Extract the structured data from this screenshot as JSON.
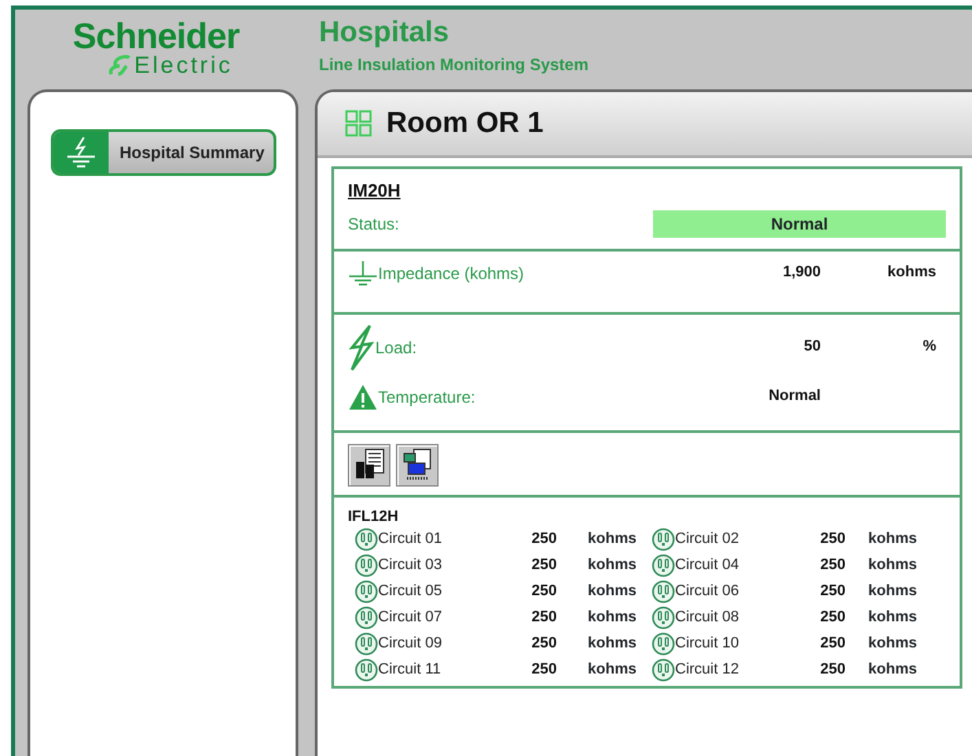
{
  "brand": {
    "name": "Schneider",
    "sub": "Electric"
  },
  "app": {
    "title": "Hospitals",
    "subtitle": "Line Insulation Monitoring System"
  },
  "sidebar": {
    "items": [
      {
        "label": "Hospital Summary",
        "selected": true
      }
    ]
  },
  "room": {
    "title": "Room OR 1"
  },
  "device": {
    "name": "IM20H",
    "status_label": "Status:",
    "status": "Normal",
    "groups": [
      {
        "items": [
          {
            "kind": "impedance",
            "label": "Impedance (kohms)",
            "value": "1,900",
            "unit": "kohms"
          }
        ]
      },
      {
        "items": [
          {
            "kind": "load",
            "label": "Load:",
            "value": "50",
            "unit": "%"
          },
          {
            "kind": "temperature",
            "label": "Temperature:",
            "value": "Normal"
          }
        ]
      }
    ]
  },
  "tools": [
    {
      "kind": "report"
    },
    {
      "kind": "monitor"
    }
  ],
  "circuits": {
    "title": "IFL12H",
    "items": [
      {
        "name": "Circuit 01",
        "value": "250",
        "unit": "kohms"
      },
      {
        "name": "Circuit 02",
        "value": "250",
        "unit": "kohms"
      },
      {
        "name": "Circuit 03",
        "value": "250",
        "unit": "kohms"
      },
      {
        "name": "Circuit 04",
        "value": "250",
        "unit": "kohms"
      },
      {
        "name": "Circuit 05",
        "value": "250",
        "unit": "kohms"
      },
      {
        "name": "Circuit 06",
        "value": "250",
        "unit": "kohms"
      },
      {
        "name": "Circuit 07",
        "value": "250",
        "unit": "kohms"
      },
      {
        "name": "Circuit 08",
        "value": "250",
        "unit": "kohms"
      },
      {
        "name": "Circuit 09",
        "value": "250",
        "unit": "kohms"
      },
      {
        "name": "Circuit 10",
        "value": "250",
        "unit": "kohms"
      },
      {
        "name": "Circuit 11",
        "value": "250",
        "unit": "kohms"
      },
      {
        "name": "Circuit 12",
        "value": "250",
        "unit": "kohms"
      }
    ]
  }
}
